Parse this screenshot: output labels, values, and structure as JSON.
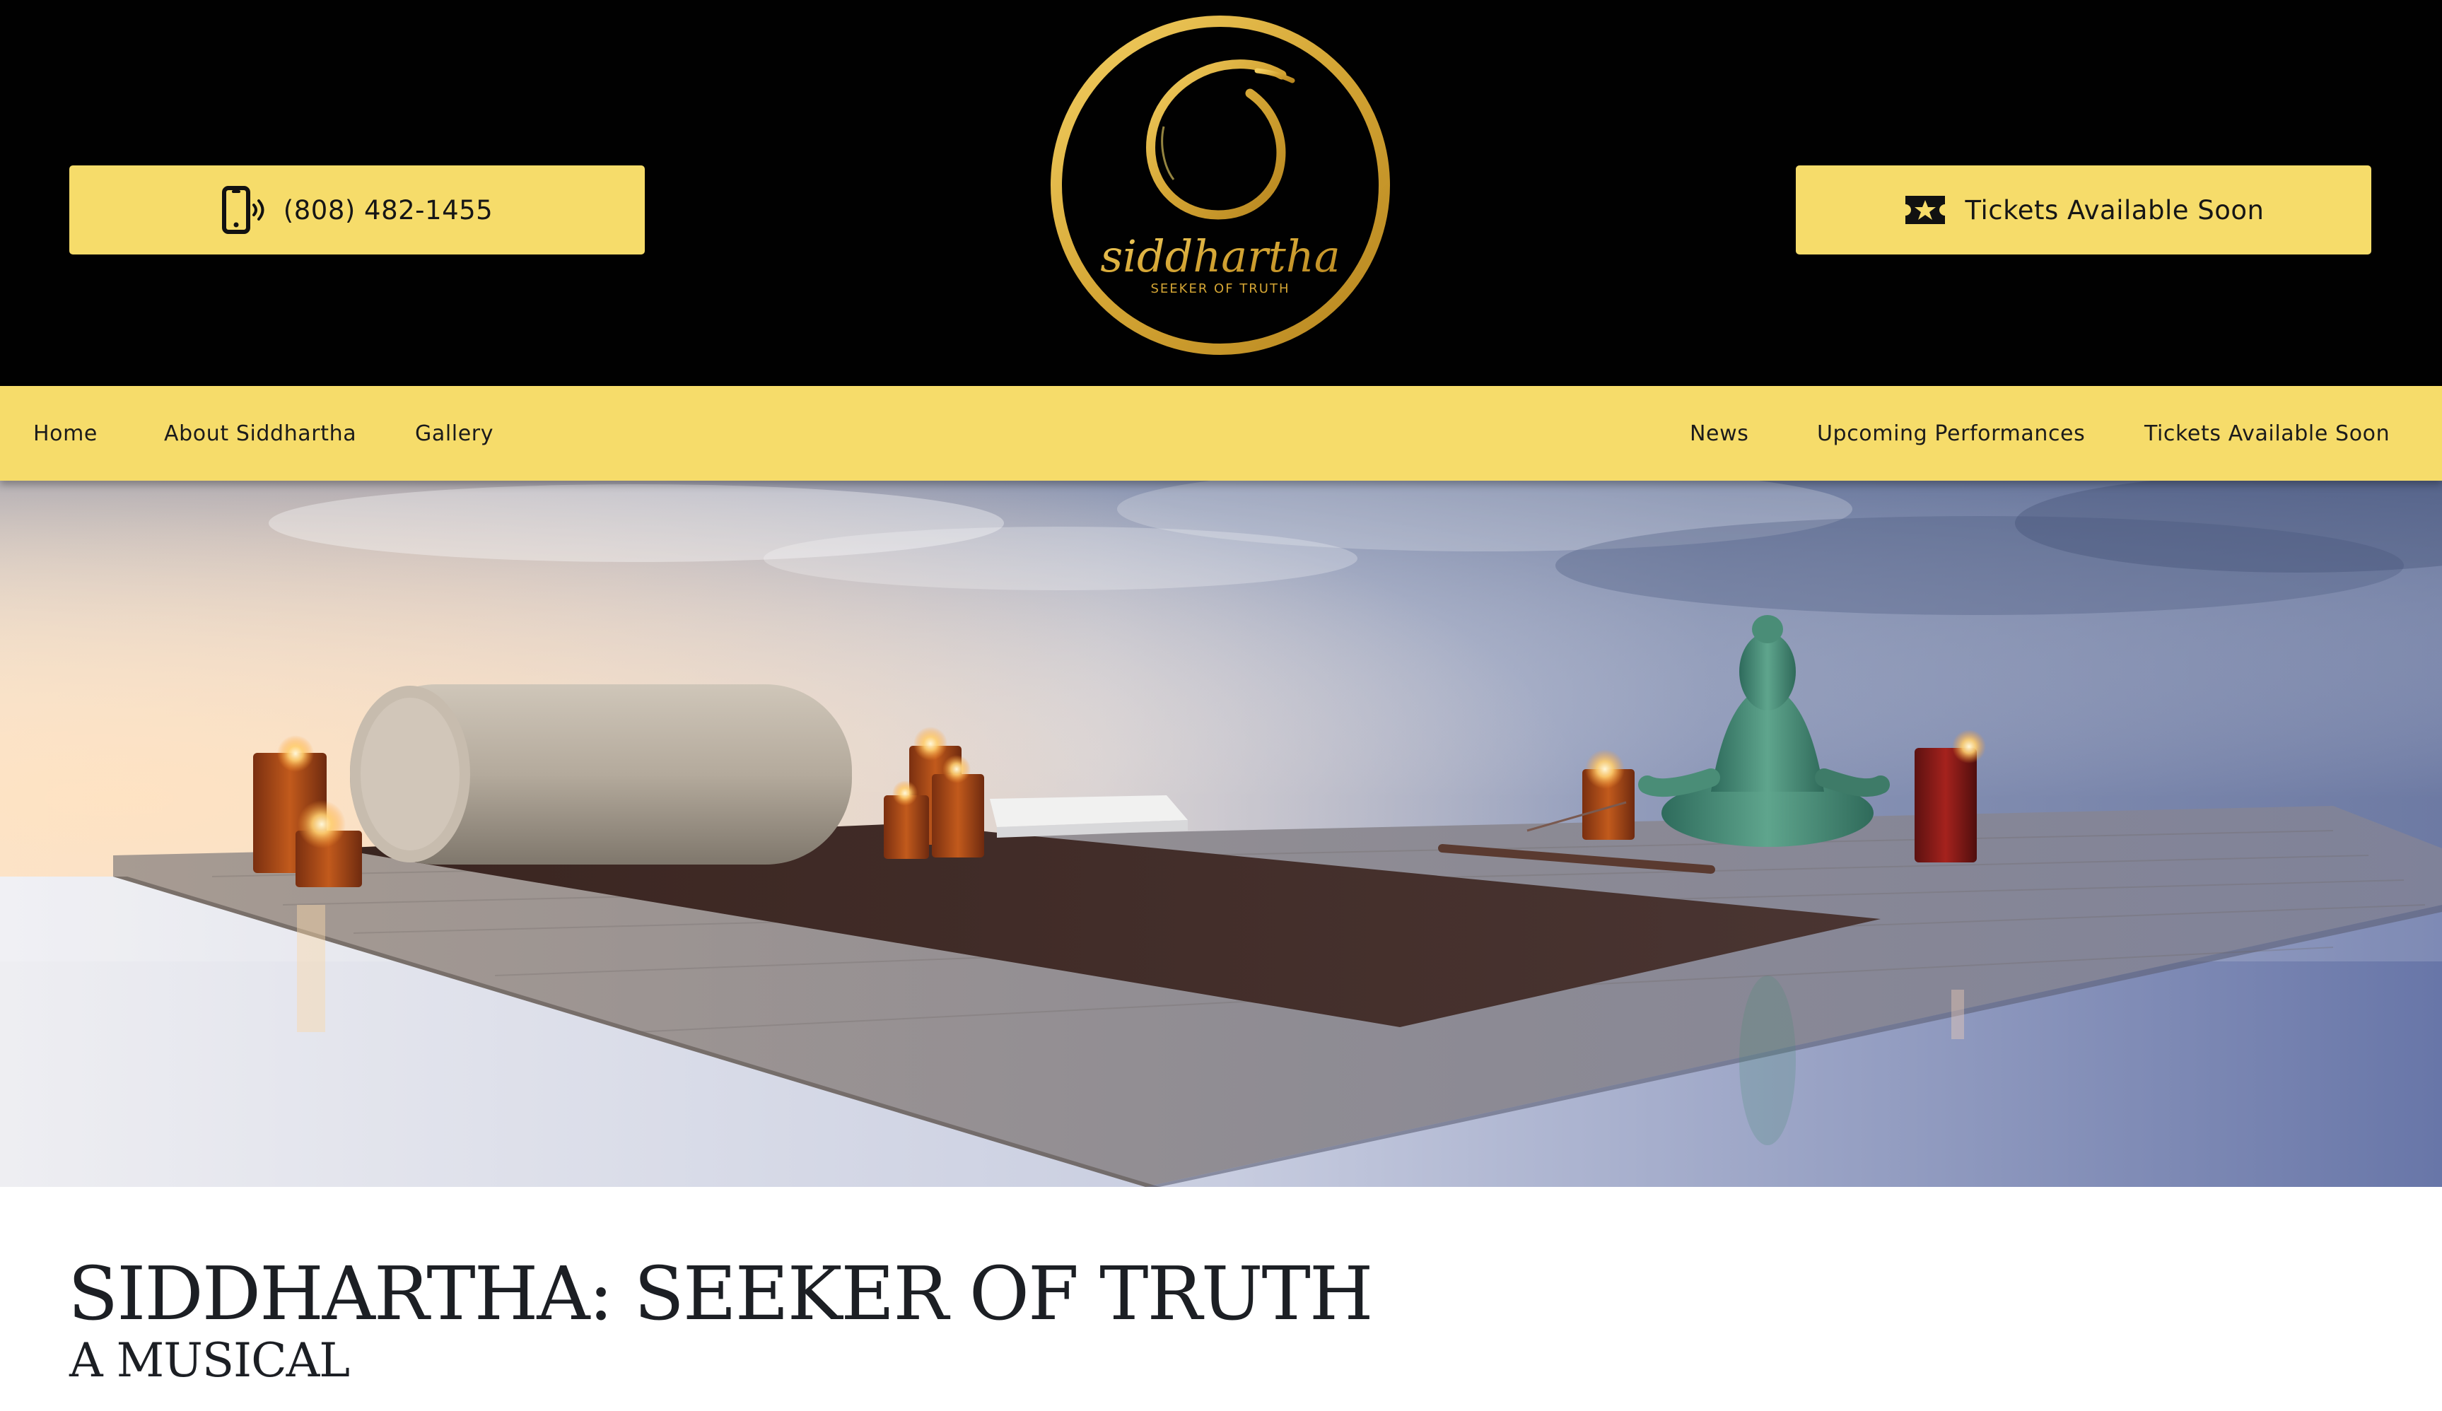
{
  "header": {
    "phone_label": "(808) 482-1455",
    "tickets_label": "Tickets Available Soon",
    "logo": {
      "wordmark": "siddhartha",
      "tagline": "SEEKER OF TRUTH"
    }
  },
  "nav": {
    "items": [
      {
        "label": "Home"
      },
      {
        "label": "About Siddhartha"
      },
      {
        "label": "Gallery"
      },
      {
        "label": "News"
      },
      {
        "label": "Upcoming Performances"
      },
      {
        "label": "Tickets Available Soon"
      }
    ]
  },
  "main": {
    "title": "SIDDHARTHA: SEEKER OF TRUTH",
    "subtitle": "A MUSICAL"
  },
  "colors": {
    "header_bg": "#010101",
    "accent_yellow": "#f6dc6a",
    "logo_gold": "#d9ad3b",
    "text_dark": "#1c1f24"
  },
  "icons": {
    "phone": "phone-icon",
    "ticket": "ticket-icon"
  }
}
